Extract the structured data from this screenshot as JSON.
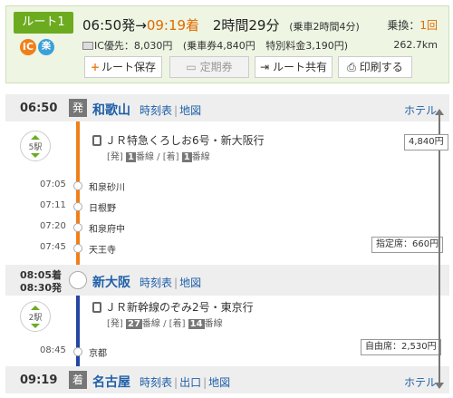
{
  "summary": {
    "route_label": "ルート1",
    "badge_ic": "IC",
    "badge_raku": "楽",
    "depart": "06:50発",
    "arrow": "→",
    "arrive": "09:19着",
    "duration": "2時間29分",
    "ride_time": "(乗車2時間4分)",
    "transfers_label": "乗換：",
    "transfers_count": "1回",
    "fare_ic": "IC優先：8,030円",
    "fare_detail": "(乗車券4,840円",
    "fare_special": "特別料金3,190円)",
    "distance": "262.7km"
  },
  "buttons": {
    "save": "ルート保存",
    "pass": "定期券",
    "share": "ルート共有",
    "print": "印刷する"
  },
  "stations": {
    "wakayama": {
      "time": "06:50",
      "mark": "発",
      "name": "和歌山",
      "link1": "時刻表",
      "link2": "地図",
      "hotel": "ホテル"
    },
    "shinosaka": {
      "time_arr": "08:05着",
      "time_dep": "08:30発",
      "name": "新大阪",
      "link1": "時刻表",
      "link2": "地図"
    },
    "nagoya": {
      "time": "09:19",
      "mark": "着",
      "name": "名古屋",
      "link1": "時刻表",
      "link2": "出口",
      "link3": "地図",
      "hotel": "ホテル"
    }
  },
  "legs": [
    {
      "stop_count": "5駅",
      "train": "ＪＲ特急くろしお6号・新大阪行",
      "dep_label": "[発]",
      "dep_track": "1",
      "track_suffix": "番線",
      "slash": "/",
      "arr_label": "[着]",
      "arr_track": "1",
      "stops": [
        {
          "time": "07:05",
          "name": "和泉砂川"
        },
        {
          "time": "07:11",
          "name": "日根野"
        },
        {
          "time": "07:20",
          "name": "和泉府中"
        },
        {
          "time": "07:45",
          "name": "天王寺"
        }
      ],
      "seat_fare": "指定席：660円",
      "color": "#f07f1a"
    },
    {
      "stop_count": "2駅",
      "train": "ＪＲ新幹線のぞみ2号・東京行",
      "dep_label": "[発]",
      "dep_track": "27",
      "track_suffix": "番線",
      "slash": "/",
      "arr_label": "[着]",
      "arr_track": "14",
      "stops": [
        {
          "time": "08:45",
          "name": "京都"
        }
      ],
      "seat_fare": "自由席：2,530円",
      "color": "#2446a3"
    }
  ],
  "ticket_fare": "4,840円"
}
